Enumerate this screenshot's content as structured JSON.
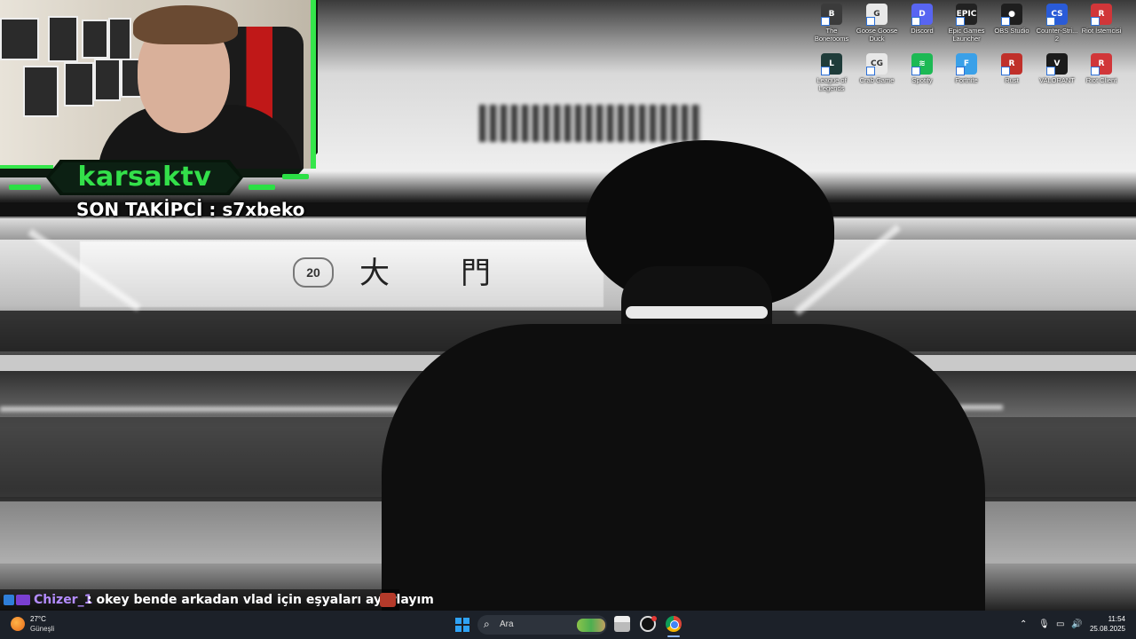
{
  "overlay": {
    "channel_name": "karsaktv",
    "last_follower": "SON TAKİPCİ : s7xbeko",
    "accent_color": "#33e04a"
  },
  "wallpaper": {
    "sign_number": "20",
    "sign_kanji": "大門"
  },
  "desktop_icons": [
    {
      "label": "The Bonerooms",
      "icon": "bonerooms-icon",
      "color": "#3b3b3b",
      "glyph": "B"
    },
    {
      "label": "Goose Goose Duck",
      "icon": "goose-goose-duck-icon",
      "color": "#e9e9e9",
      "glyph": "G"
    },
    {
      "label": "Discord",
      "icon": "discord-icon",
      "color": "#5865f2",
      "glyph": "D"
    },
    {
      "label": "Epic Games Launcher",
      "icon": "epic-games-icon",
      "color": "#222222",
      "glyph": "EPIC"
    },
    {
      "label": "OBS Studio",
      "icon": "obs-studio-icon",
      "color": "#1e1e1e",
      "glyph": "●"
    },
    {
      "label": "Counter-Stri... 2",
      "icon": "counter-strike-icon",
      "color": "#2a5bd7",
      "glyph": "CS"
    },
    {
      "label": "Riot İstemcisi",
      "icon": "riot-client-icon",
      "color": "#d13639",
      "glyph": "R"
    },
    {
      "label": "League of Legends",
      "icon": "league-of-legends-icon",
      "color": "#1f3c3a",
      "glyph": "L"
    },
    {
      "label": "Crab Game",
      "icon": "crab-game-icon",
      "color": "#e8e8e8",
      "glyph": "CG"
    },
    {
      "label": "Spotify",
      "icon": "spotify-icon",
      "color": "#1db954",
      "glyph": "≋"
    },
    {
      "label": "Fortnite",
      "icon": "fortnite-icon",
      "color": "#3aa0e8",
      "glyph": "F"
    },
    {
      "label": "Rust",
      "icon": "rust-icon",
      "color": "#c0302a",
      "glyph": "R"
    },
    {
      "label": "VALORANT",
      "icon": "valorant-icon",
      "color": "#1b1b1b",
      "glyph": "V"
    },
    {
      "label": "Riot Client",
      "icon": "riot-client-2-icon",
      "color": "#d13639",
      "glyph": "R"
    }
  ],
  "chat": {
    "username": "Chizer_1",
    "message": ": okey bende arkadan vlad için eşyaları ayarlayım"
  },
  "taskbar": {
    "weather_temp": "27°C",
    "weather_condition": "Güneşli",
    "search_placeholder": "Ara",
    "time": "11:54",
    "date": "25.08.2025"
  }
}
